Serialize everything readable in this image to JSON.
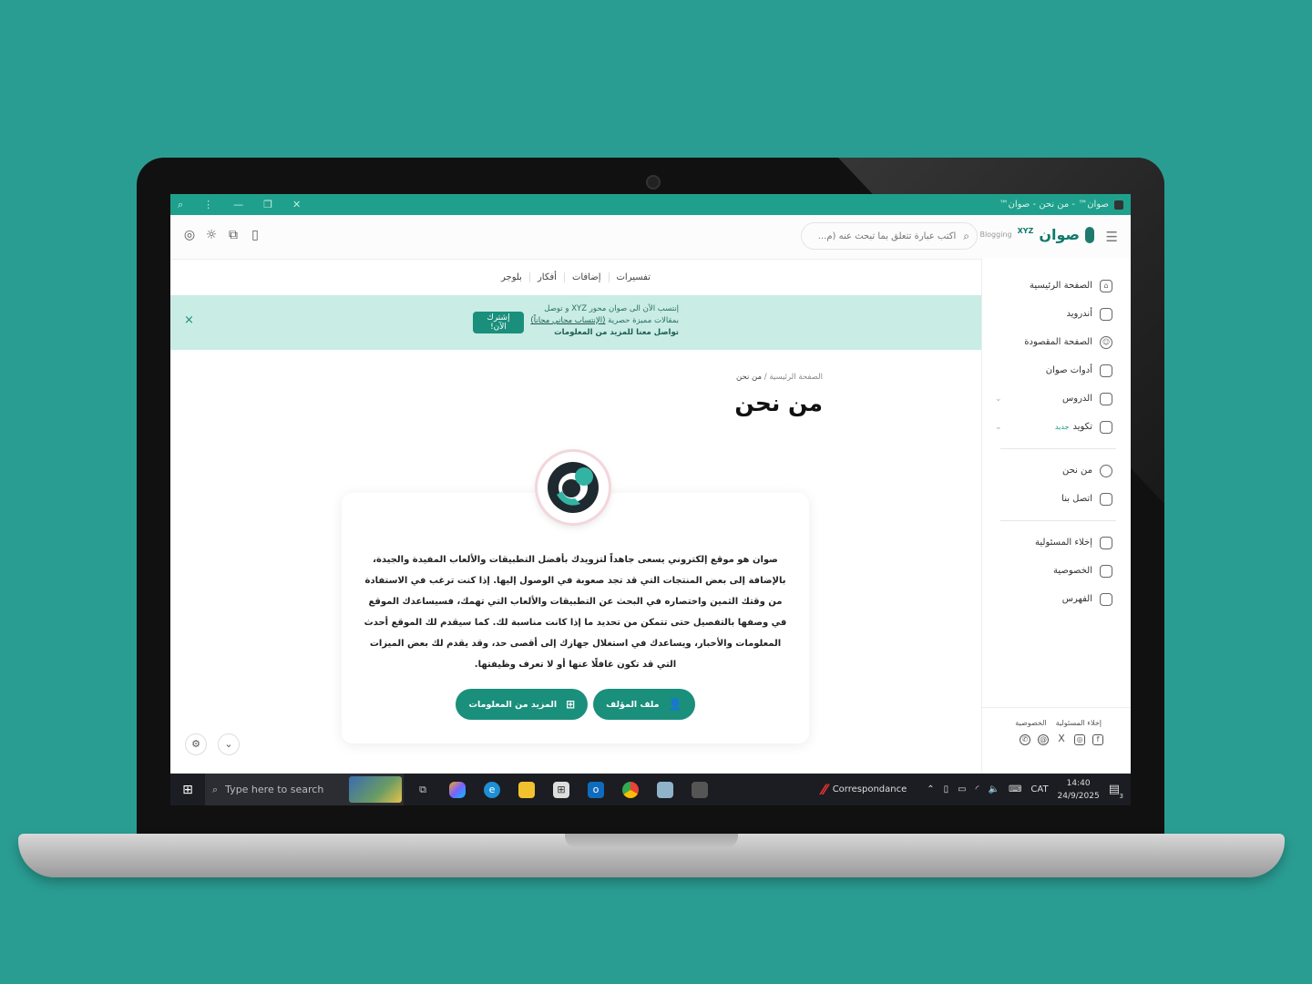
{
  "colors": {
    "accent": "#1a8f7c",
    "banner_bg": "#c9ece5",
    "desktop_bg": "#2a9d93"
  },
  "window": {
    "title": "صوان™ - من نحن - صوان™",
    "controls": [
      "search-icon",
      "menu-dots-icon",
      "minimize-icon",
      "restore-icon",
      "close-icon"
    ]
  },
  "header": {
    "logo_text": "صوان",
    "logo_sup": "XYZ",
    "logo_sub": "Blogging",
    "search_placeholder": "اكتب عبارة تتعلق بما تبحث عنه (م...",
    "icons": [
      "account-icon",
      "theme-sun-icon",
      "translate-icon",
      "bookmark-icon"
    ]
  },
  "subnav": [
    "تفسيرات",
    "إضافات",
    "أفكار",
    "بلوجر"
  ],
  "banner": {
    "line1": "إنتسب الآن الى صوان محور XYZ و توصل",
    "line2_prefix": "بمقالات مميزة حصرية",
    "line2_link": "(الإنتساب مجاني مجاناً)",
    "line3": "تواصل معنا للمزيد من المعلومات",
    "button": "إشترك الآن!",
    "close": "×"
  },
  "sidebar": {
    "items": [
      {
        "label": "الصفحة الرئيسية",
        "icon": "home-icon"
      },
      {
        "label": "أندرويد",
        "icon": "android-icon"
      },
      {
        "label": "الصفحة المقصودة",
        "icon": "smile-icon"
      },
      {
        "label": "أدوات صوان",
        "icon": "tools-icon"
      },
      {
        "label": "الدروس",
        "icon": "lessons-icon",
        "chevron": "⌄"
      },
      {
        "label": "تكويد",
        "badge": "جديد",
        "icon": "code-icon",
        "chevron": "⌄"
      }
    ],
    "items2": [
      {
        "label": "من نحن",
        "icon": "users-icon"
      },
      {
        "label": "اتصل بنا",
        "icon": "mail-icon"
      }
    ],
    "items3": [
      {
        "label": "إخلاء المسئولية",
        "icon": "doc-icon"
      },
      {
        "label": "الخصوصية",
        "icon": "doc-icon"
      },
      {
        "label": "الفهرس",
        "icon": "doc-icon"
      }
    ],
    "footer_links": [
      "إخلاء المسئولية",
      "الخصوصية"
    ],
    "socials": [
      "whatsapp-icon",
      "threads-icon",
      "x-icon",
      "instagram-icon",
      "facebook-icon"
    ]
  },
  "main": {
    "breadcrumb_home": "الصفحة الرئيسية",
    "breadcrumb_sep": "/",
    "breadcrumb_current": "من نحن",
    "title": "من نحن",
    "about_text": "صوان هو موقع إلكتروني يسعى جاهداً لتزويدك بأفضل التطبيقات والألعاب المفيدة والجيدة، بالإضافة إلى بعض المنتجات التي قد تجد صعوبة في الوصول إليها. إذا كنت ترغب في الاستفادة من وقتك الثمين واختصاره في البحث عن التطبيقات والألعاب التي تهمك، فسيساعدك الموقع في وصفها بالتفصيل حتى تتمكن من تحديد ما إذا كانت مناسبة لك. كما سيقدم لك الموقع أحدث المعلومات والأخبار، ويساعدك في استغلال جهازك إلى أقصى حد، وقد يقدم لك بعض الميزات التي قد تكون غافلًا عنها أو لا تعرف وظيفتها.",
    "btn_author": "ملف المؤلف",
    "btn_more": "المزيد من المعلومات"
  },
  "taskbar": {
    "search_placeholder": "Type here to search",
    "tray_app": "Correspondance",
    "lang": "CAT",
    "time": "14:40",
    "date": "24/9/2025",
    "notif_count": "3"
  }
}
